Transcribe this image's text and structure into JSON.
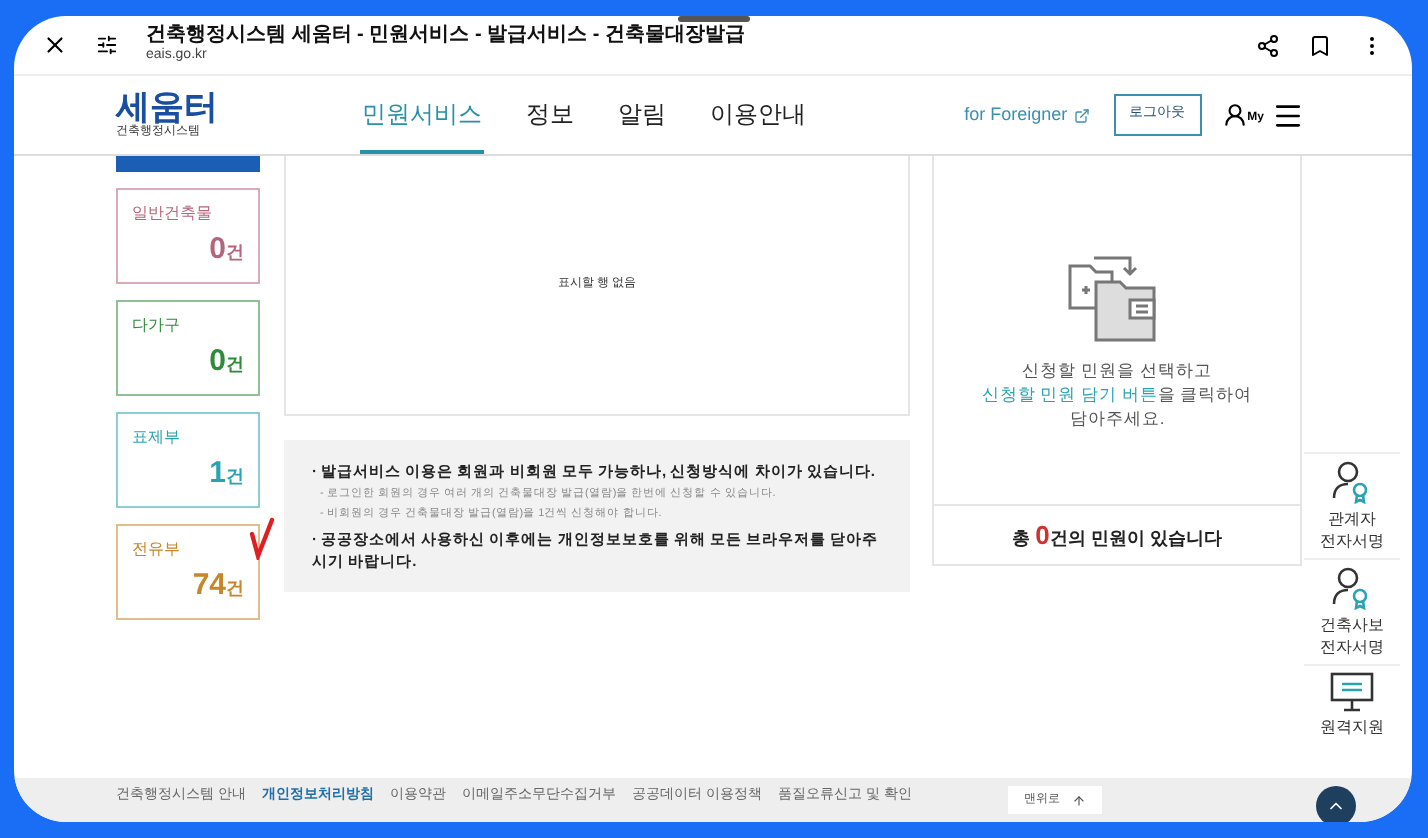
{
  "browser": {
    "title": "건축행정시스템 세움터 - 민원서비스 - 발급서비스 - 건축물대장발급",
    "url": "eais.go.kr"
  },
  "header": {
    "logo": "세움터",
    "logo_sub": "건축행정시스템",
    "nav": [
      {
        "label": "민원서비스",
        "selected": true
      },
      {
        "label": "정보",
        "selected": false
      },
      {
        "label": "알림",
        "selected": false
      },
      {
        "label": "이용안내",
        "selected": false
      }
    ],
    "foreign": "for Foreigner",
    "logout": "로그아웃",
    "my": "My"
  },
  "cards": [
    {
      "label": "일반건축물",
      "count": "0",
      "unit": "건",
      "color": "#b5657a"
    },
    {
      "label": "다가구",
      "count": "0",
      "unit": "건",
      "color": "#2e8b3a"
    },
    {
      "label": "표제부",
      "count": "1",
      "unit": "건",
      "color": "#2aa3b0"
    },
    {
      "label": "전유부",
      "count": "74",
      "unit": "건",
      "color": "#c8862a",
      "marked": true
    }
  ],
  "table": {
    "empty": "표시할 행 없음"
  },
  "notice": [
    {
      "kind": "main",
      "text": "· 발급서비스 이용은 회원과 비회원 모두 가능하나, 신청방식에 차이가 있습니다."
    },
    {
      "kind": "sub",
      "text": "- 로그인한 회원의 경우 여러 개의 건축물대장 발급(열람)을 한번에 신청할 수 있습니다."
    },
    {
      "kind": "sub",
      "text": "- 비회원의 경우 건축물대장 발급(열람)을 1건씩 신청해야 합니다."
    },
    {
      "kind": "main",
      "text": "· 공공장소에서 사용하신 이후에는 개인정보보호를 위해 모든 브라우저를 닫아주시기 바랍니다."
    }
  ],
  "cart": {
    "line1": "신청할 민원을 선택하고",
    "highlight": "신청할 민원 담기 버튼",
    "line2_rest": "을 클릭하여",
    "line3": "담아주세요.",
    "total_prefix": "총 ",
    "total_count": "0",
    "total_suffix": "건의 민원이 있습니다"
  },
  "side_menu": [
    {
      "kind": "person",
      "lines": [
        "관계자",
        "전자서명"
      ]
    },
    {
      "kind": "person",
      "lines": [
        "건축사보",
        "전자서명"
      ]
    },
    {
      "kind": "monitor",
      "lines": [
        "원격지원"
      ]
    }
  ],
  "footer": {
    "links": [
      {
        "label": "건축행정시스템 안내",
        "kind": "plain"
      },
      {
        "label": "개인정보처리방침",
        "kind": "emphasis"
      },
      {
        "label": "이용약관",
        "kind": "plain"
      },
      {
        "label": "이메일주소무단수집거부",
        "kind": "plain"
      },
      {
        "label": "공공데이터 이용정책",
        "kind": "plain"
      },
      {
        "label": "품질오류신고 및 확인",
        "kind": "plain"
      }
    ],
    "top": "맨위로"
  }
}
